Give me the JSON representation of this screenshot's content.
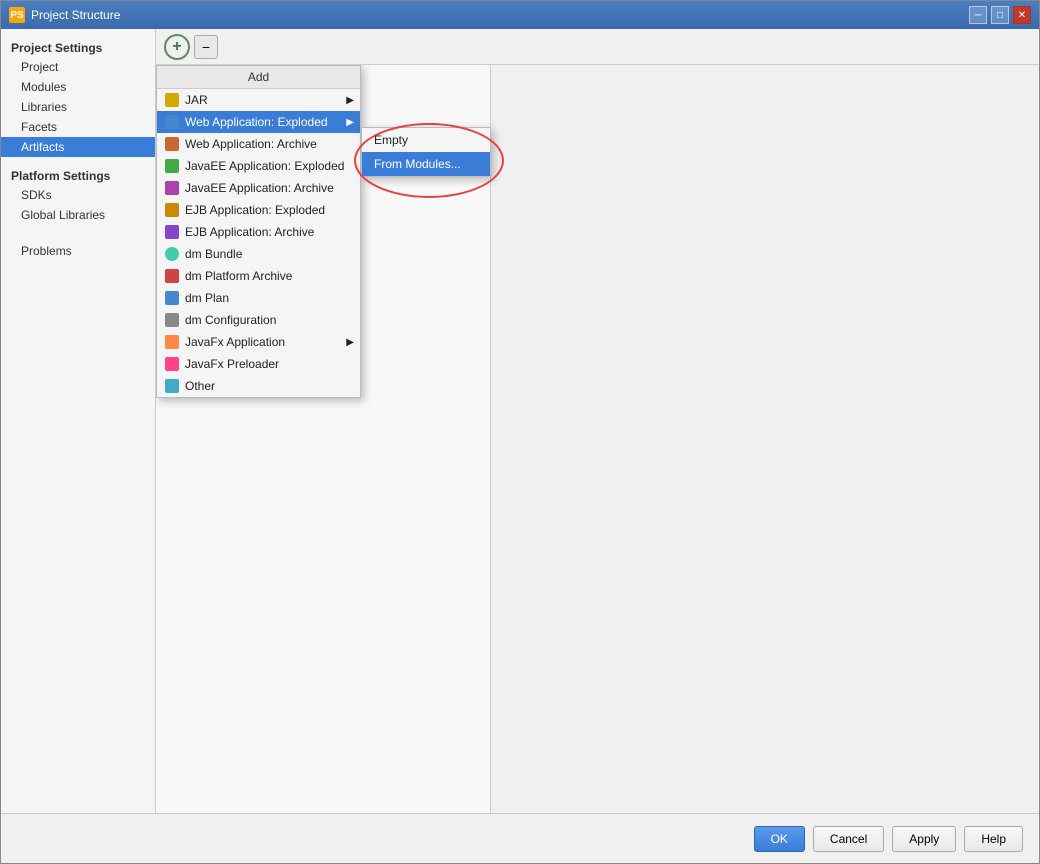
{
  "window": {
    "title": "Project Structure",
    "icon": "PS"
  },
  "sidebar": {
    "project_settings_label": "Project Settings",
    "items_project_settings": [
      {
        "id": "project",
        "label": "Project"
      },
      {
        "id": "modules",
        "label": "Modules"
      },
      {
        "id": "libraries",
        "label": "Libraries"
      },
      {
        "id": "facets",
        "label": "Facets"
      },
      {
        "id": "artifacts",
        "label": "Artifacts",
        "active": true
      }
    ],
    "platform_settings_label": "Platform Settings",
    "items_platform_settings": [
      {
        "id": "sdks",
        "label": "SDKs"
      },
      {
        "id": "global-libraries",
        "label": "Global Libraries"
      }
    ],
    "problems_label": "Problems"
  },
  "toolbar": {
    "add_label": "+",
    "remove_label": "−"
  },
  "dropdown": {
    "header": "Add",
    "items": [
      {
        "id": "jar",
        "label": "JAR",
        "icon_color": "#d4a800",
        "has_arrow": true
      },
      {
        "id": "web-app-exploded",
        "label": "Web Application: Exploded",
        "icon_color": "#4488cc",
        "selected": true,
        "has_arrow": true
      },
      {
        "id": "web-app-archive",
        "label": "Web Application: Archive",
        "icon_color": "#cc6633",
        "has_arrow": false
      },
      {
        "id": "javaee-exploded",
        "label": "JavaEE Application: Exploded",
        "icon_color": "#44aa44",
        "has_arrow": false
      },
      {
        "id": "javaee-archive",
        "label": "JavaEE Application: Archive",
        "icon_color": "#aa44aa",
        "has_arrow": false
      },
      {
        "id": "ejb-exploded",
        "label": "EJB Application: Exploded",
        "icon_color": "#cc8800",
        "has_arrow": false
      },
      {
        "id": "ejb-archive",
        "label": "EJB Application: Archive",
        "icon_color": "#8844cc",
        "has_arrow": false
      },
      {
        "id": "dm-bundle",
        "label": "dm Bundle",
        "icon_color": "#44ccaa",
        "has_arrow": false
      },
      {
        "id": "dm-platform-archive",
        "label": "dm Platform Archive",
        "icon_color": "#cc4444",
        "has_arrow": false
      },
      {
        "id": "dm-plan",
        "label": "dm Plan",
        "icon_color": "#4488cc",
        "has_arrow": false
      },
      {
        "id": "dm-configuration",
        "label": "dm Configuration",
        "icon_color": "#888888",
        "has_arrow": false
      },
      {
        "id": "javafx-app",
        "label": "JavaFx Application",
        "icon_color": "#ff8844",
        "has_arrow": true
      },
      {
        "id": "javafx-preloader",
        "label": "JavaFx Preloader",
        "icon_color": "#ff4488",
        "has_arrow": false
      },
      {
        "id": "other",
        "label": "Other",
        "icon_color": "#44aacc",
        "has_arrow": false
      }
    ]
  },
  "submenu": {
    "items": [
      {
        "id": "empty",
        "label": "Empty"
      },
      {
        "id": "from-modules",
        "label": "From Modules...",
        "active": true
      }
    ]
  },
  "bottom_buttons": {
    "ok": "OK",
    "cancel": "Cancel",
    "apply": "Apply",
    "help": "Help"
  }
}
